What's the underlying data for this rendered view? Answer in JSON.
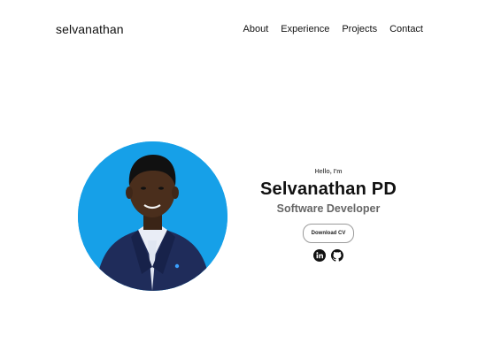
{
  "nav": {
    "logo": "selvanathan",
    "links": [
      "About",
      "Experience",
      "Projects",
      "Contact"
    ]
  },
  "hero": {
    "greeting": "Hello, I'm",
    "name": "Selvanathan PD",
    "role": "Software Developer",
    "cv_button": "Download CV",
    "socials": [
      {
        "icon": "linkedin-icon"
      },
      {
        "icon": "github-icon"
      }
    ],
    "photo_background": "#16a0e8"
  }
}
